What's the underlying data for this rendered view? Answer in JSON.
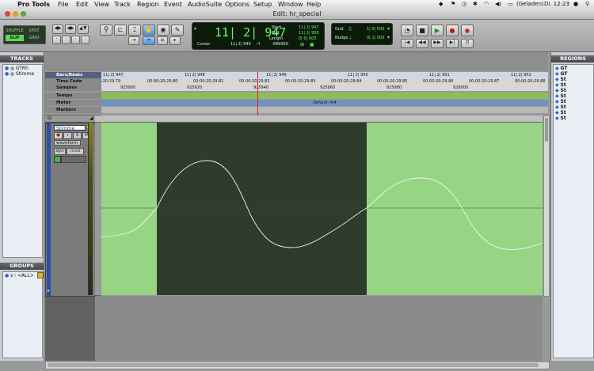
{
  "menubar": {
    "app": "Pro Tools",
    "items": [
      "File",
      "Edit",
      "View",
      "Track",
      "Region",
      "Event",
      "AudioSuite",
      "Options",
      "Setup",
      "Window",
      "Help"
    ],
    "battery": "(Geladen)",
    "clock": "Di. 12:23"
  },
  "window": {
    "title": "Edit: hr_special"
  },
  "toolbar": {
    "modes": {
      "shuffle": "SHUFFLE",
      "spot": "SPOT",
      "slip": "SLIP",
      "grid": "GRID"
    },
    "main_counter": "11| 2| 947",
    "cursor_label": "Cursor",
    "cursor_value": "11| 2| 949",
    "cursor_sample": "-999950",
    "start_label": "Start",
    "start_value": "11| 2| 947",
    "end_label": "End",
    "end_value": "11| 2| 950",
    "length_label": "Length",
    "length_value": "0| 0| 003",
    "grid_label": "Grid",
    "grid_value": "1| 0| 000",
    "nudge_label": "Nudge",
    "nudge_value": "0| 1| 000"
  },
  "tracks_panel": {
    "title": "TRACKS",
    "items": [
      "GTRh",
      "Stimme"
    ]
  },
  "groups_panel": {
    "title": "GROUPS",
    "items": [
      "<ALL>"
    ]
  },
  "regions_panel": {
    "title": "REGIONS",
    "items": [
      "GT",
      "GT",
      "St",
      "St",
      "St",
      "St",
      "St",
      "St",
      "St",
      "St"
    ]
  },
  "rulers": {
    "bars_label": "Bars|Beats",
    "bars_ticks": [
      "11| 2| 947",
      "11| 2| 948",
      "11| 2| 949",
      "11| 2| 950",
      "11| 2| 951",
      "11| 2| 952"
    ],
    "timecode_label": "Time Code",
    "timecode_ticks": [
      ":20:29.79",
      "00:00:20:29.80",
      "00:00:20:29.81",
      "00:00:20:29.82",
      "00:00:20:29.83",
      "00:00:20:29.84",
      "00:00:20:29.85",
      "00:00:20:29.86",
      "00:00:20:29.87",
      "00:00:20:29.88"
    ],
    "samples_label": "Samples",
    "samples_ticks": [
      "925900",
      "925920",
      "925940",
      "925960",
      "925980",
      "926000"
    ],
    "tempo_label": "Tempo",
    "meter_label": "Meter",
    "meter_value": "Default: 4/4",
    "markers_label": "Markers"
  },
  "track": {
    "name": "Stimme",
    "view": "waveform",
    "dyn": "dyn",
    "automation": "read",
    "btn_record": "●",
    "btn_solo": "S",
    "btn_mute": "M"
  },
  "colors": {
    "region": "#97d484",
    "selection": "#2e3c2b",
    "waveform_line": "#c9d6c6",
    "counter_green": "#63ff5a"
  }
}
